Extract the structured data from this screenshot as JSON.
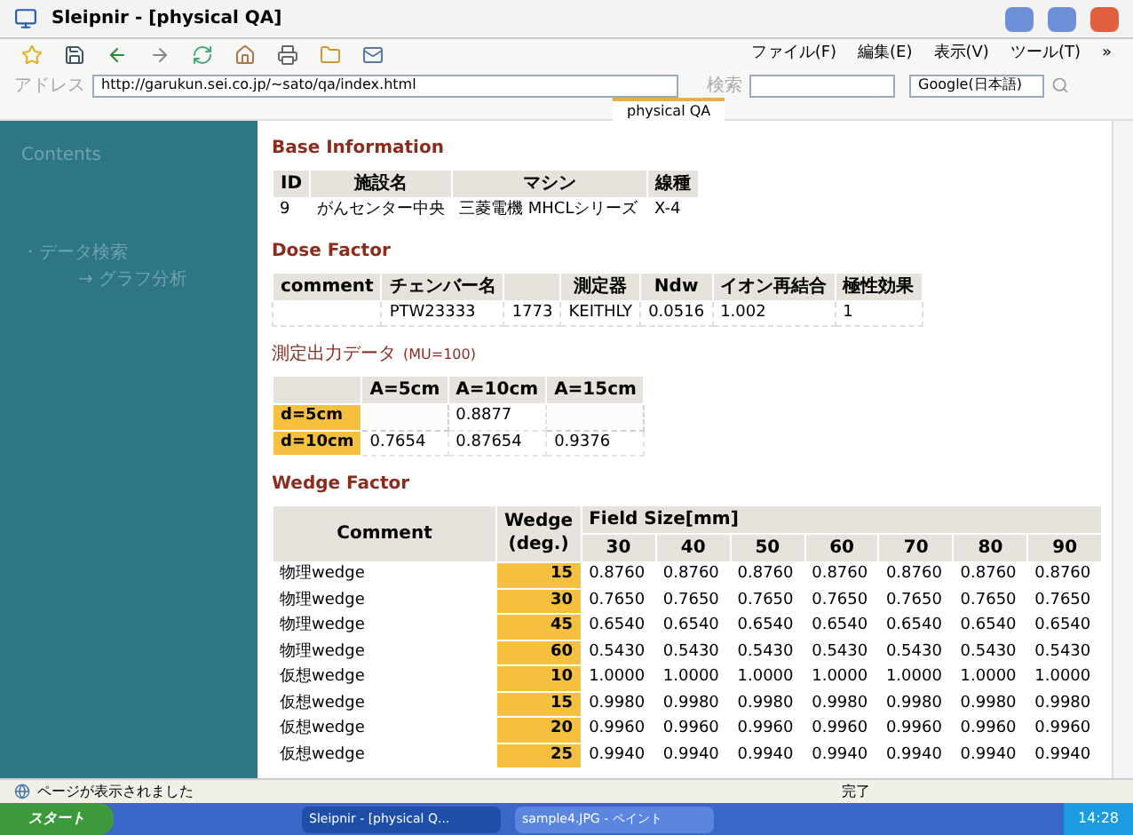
{
  "window": {
    "title": "Sleipnir - [physical QA]"
  },
  "menu": [
    "ファイル(F)",
    "編集(E)",
    "表示(V)",
    "ツール(T)",
    "»"
  ],
  "address_bar": {
    "label": "アドレス",
    "url": "http://garukun.sei.co.jp/~sato/qa/index.html",
    "search_label": "検索",
    "engine": "Google(日本語)"
  },
  "tabs": [
    {
      "label": "physical QA",
      "selected": true
    }
  ],
  "sidebar": {
    "heading": "Contents",
    "items": [
      {
        "label": "・データ検索",
        "children": [
          {
            "label": "→ グラフ分析"
          }
        ]
      }
    ]
  },
  "base_information": {
    "title": "Base Information",
    "columns": [
      "ID",
      "施設名",
      "マシン",
      "線種"
    ],
    "rows": [
      [
        "9",
        "がんセンター中央",
        "三菱電機 MHCLシリーズ",
        "X-4"
      ]
    ]
  },
  "dose_factor": {
    "title": "Dose Factor",
    "columns": [
      "comment",
      "チェンバー名",
      null,
      "測定器",
      "Ndw",
      "イオン再結合",
      "極性効果"
    ],
    "rows": [
      [
        null,
        "PTW23333",
        "1773",
        "KEITHLY",
        "0.0516",
        "1.002",
        "1"
      ]
    ]
  },
  "output_data": {
    "title": "測定出力データ",
    "note": "(MU=100)",
    "columns": [
      "A=5cm",
      "A=10cm",
      "A=15cm"
    ],
    "rows": [
      {
        "label": "d=5cm",
        "values": [
          {
            "blank": true
          },
          {
            "text": "0.8877"
          },
          {
            "blank": true
          }
        ]
      },
      {
        "label": "d=10cm",
        "values": [
          {
            "text": "0.7654"
          },
          {
            "text": "0.87654"
          },
          {
            "text": "0.9376"
          }
        ]
      }
    ]
  },
  "wedge_factor": {
    "title": "Wedge Factor",
    "comment_header": "Comment",
    "wedge_header": "Wedge (deg.)",
    "group_header": "Field Size[mm]",
    "columns": [
      "30",
      "40",
      "50",
      "60",
      "70",
      "80",
      "90"
    ],
    "rows": [
      {
        "comment": "物理wedge",
        "wedge": "15",
        "values": [
          "0.8760",
          "0.8760",
          "0.8760",
          "0.8760",
          "0.8760",
          "0.8760",
          "0.8760"
        ]
      },
      {
        "comment": "物理wedge",
        "wedge": "30",
        "values": [
          "0.7650",
          "0.7650",
          "0.7650",
          "0.7650",
          "0.7650",
          "0.7650",
          "0.7650"
        ]
      },
      {
        "comment": "物理wedge",
        "wedge": "45",
        "values": [
          "0.6540",
          "0.6540",
          "0.6540",
          "0.6540",
          "0.6540",
          "0.6540",
          "0.6540"
        ]
      },
      {
        "comment": "物理wedge",
        "wedge": "60",
        "values": [
          "0.5430",
          "0.5430",
          "0.5430",
          "0.5430",
          "0.5430",
          "0.5430",
          "0.5430"
        ]
      },
      {
        "comment": "仮想wedge",
        "wedge": "10",
        "values": [
          "1.0000",
          "1.0000",
          "1.0000",
          "1.0000",
          "1.0000",
          "1.0000",
          "1.0000"
        ]
      },
      {
        "comment": "仮想wedge",
        "wedge": "15",
        "values": [
          "0.9980",
          "0.9980",
          "0.9980",
          "0.9980",
          "0.9980",
          "0.9980",
          "0.9980"
        ]
      },
      {
        "comment": "仮想wedge",
        "wedge": "20",
        "values": [
          "0.9960",
          "0.9960",
          "0.9960",
          "0.9960",
          "0.9960",
          "0.9960",
          "0.9960"
        ]
      },
      {
        "comment": "仮想wedge",
        "wedge": "25",
        "values": [
          "0.9940",
          "0.9940",
          "0.9940",
          "0.9940",
          "0.9940",
          "0.9940",
          "0.9940"
        ]
      }
    ]
  },
  "status_bar": {
    "message": "ページが表示されました",
    "state": "完了"
  },
  "taskbar": {
    "start": "スタート",
    "windows": [
      {
        "label": "Sleipnir - [physical Q...",
        "selected": true
      },
      {
        "label": "sample4.JPG - ペイント",
        "selected": false
      }
    ],
    "clock": "14:28"
  }
}
